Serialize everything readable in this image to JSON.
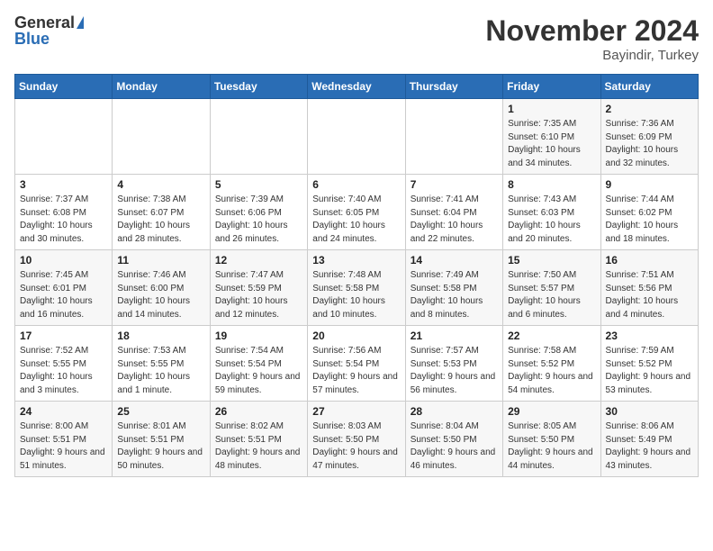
{
  "header": {
    "logo_general": "General",
    "logo_blue": "Blue",
    "month_title": "November 2024",
    "location": "Bayindir, Turkey"
  },
  "days_of_week": [
    "Sunday",
    "Monday",
    "Tuesday",
    "Wednesday",
    "Thursday",
    "Friday",
    "Saturday"
  ],
  "weeks": [
    [
      {
        "day": "",
        "sunrise": "",
        "sunset": "",
        "daylight": ""
      },
      {
        "day": "",
        "sunrise": "",
        "sunset": "",
        "daylight": ""
      },
      {
        "day": "",
        "sunrise": "",
        "sunset": "",
        "daylight": ""
      },
      {
        "day": "",
        "sunrise": "",
        "sunset": "",
        "daylight": ""
      },
      {
        "day": "",
        "sunrise": "",
        "sunset": "",
        "daylight": ""
      },
      {
        "day": "1",
        "sunrise": "Sunrise: 7:35 AM",
        "sunset": "Sunset: 6:10 PM",
        "daylight": "Daylight: 10 hours and 34 minutes."
      },
      {
        "day": "2",
        "sunrise": "Sunrise: 7:36 AM",
        "sunset": "Sunset: 6:09 PM",
        "daylight": "Daylight: 10 hours and 32 minutes."
      }
    ],
    [
      {
        "day": "3",
        "sunrise": "Sunrise: 7:37 AM",
        "sunset": "Sunset: 6:08 PM",
        "daylight": "Daylight: 10 hours and 30 minutes."
      },
      {
        "day": "4",
        "sunrise": "Sunrise: 7:38 AM",
        "sunset": "Sunset: 6:07 PM",
        "daylight": "Daylight: 10 hours and 28 minutes."
      },
      {
        "day": "5",
        "sunrise": "Sunrise: 7:39 AM",
        "sunset": "Sunset: 6:06 PM",
        "daylight": "Daylight: 10 hours and 26 minutes."
      },
      {
        "day": "6",
        "sunrise": "Sunrise: 7:40 AM",
        "sunset": "Sunset: 6:05 PM",
        "daylight": "Daylight: 10 hours and 24 minutes."
      },
      {
        "day": "7",
        "sunrise": "Sunrise: 7:41 AM",
        "sunset": "Sunset: 6:04 PM",
        "daylight": "Daylight: 10 hours and 22 minutes."
      },
      {
        "day": "8",
        "sunrise": "Sunrise: 7:43 AM",
        "sunset": "Sunset: 6:03 PM",
        "daylight": "Daylight: 10 hours and 20 minutes."
      },
      {
        "day": "9",
        "sunrise": "Sunrise: 7:44 AM",
        "sunset": "Sunset: 6:02 PM",
        "daylight": "Daylight: 10 hours and 18 minutes."
      }
    ],
    [
      {
        "day": "10",
        "sunrise": "Sunrise: 7:45 AM",
        "sunset": "Sunset: 6:01 PM",
        "daylight": "Daylight: 10 hours and 16 minutes."
      },
      {
        "day": "11",
        "sunrise": "Sunrise: 7:46 AM",
        "sunset": "Sunset: 6:00 PM",
        "daylight": "Daylight: 10 hours and 14 minutes."
      },
      {
        "day": "12",
        "sunrise": "Sunrise: 7:47 AM",
        "sunset": "Sunset: 5:59 PM",
        "daylight": "Daylight: 10 hours and 12 minutes."
      },
      {
        "day": "13",
        "sunrise": "Sunrise: 7:48 AM",
        "sunset": "Sunset: 5:58 PM",
        "daylight": "Daylight: 10 hours and 10 minutes."
      },
      {
        "day": "14",
        "sunrise": "Sunrise: 7:49 AM",
        "sunset": "Sunset: 5:58 PM",
        "daylight": "Daylight: 10 hours and 8 minutes."
      },
      {
        "day": "15",
        "sunrise": "Sunrise: 7:50 AM",
        "sunset": "Sunset: 5:57 PM",
        "daylight": "Daylight: 10 hours and 6 minutes."
      },
      {
        "day": "16",
        "sunrise": "Sunrise: 7:51 AM",
        "sunset": "Sunset: 5:56 PM",
        "daylight": "Daylight: 10 hours and 4 minutes."
      }
    ],
    [
      {
        "day": "17",
        "sunrise": "Sunrise: 7:52 AM",
        "sunset": "Sunset: 5:55 PM",
        "daylight": "Daylight: 10 hours and 3 minutes."
      },
      {
        "day": "18",
        "sunrise": "Sunrise: 7:53 AM",
        "sunset": "Sunset: 5:55 PM",
        "daylight": "Daylight: 10 hours and 1 minute."
      },
      {
        "day": "19",
        "sunrise": "Sunrise: 7:54 AM",
        "sunset": "Sunset: 5:54 PM",
        "daylight": "Daylight: 9 hours and 59 minutes."
      },
      {
        "day": "20",
        "sunrise": "Sunrise: 7:56 AM",
        "sunset": "Sunset: 5:54 PM",
        "daylight": "Daylight: 9 hours and 57 minutes."
      },
      {
        "day": "21",
        "sunrise": "Sunrise: 7:57 AM",
        "sunset": "Sunset: 5:53 PM",
        "daylight": "Daylight: 9 hours and 56 minutes."
      },
      {
        "day": "22",
        "sunrise": "Sunrise: 7:58 AM",
        "sunset": "Sunset: 5:52 PM",
        "daylight": "Daylight: 9 hours and 54 minutes."
      },
      {
        "day": "23",
        "sunrise": "Sunrise: 7:59 AM",
        "sunset": "Sunset: 5:52 PM",
        "daylight": "Daylight: 9 hours and 53 minutes."
      }
    ],
    [
      {
        "day": "24",
        "sunrise": "Sunrise: 8:00 AM",
        "sunset": "Sunset: 5:51 PM",
        "daylight": "Daylight: 9 hours and 51 minutes."
      },
      {
        "day": "25",
        "sunrise": "Sunrise: 8:01 AM",
        "sunset": "Sunset: 5:51 PM",
        "daylight": "Daylight: 9 hours and 50 minutes."
      },
      {
        "day": "26",
        "sunrise": "Sunrise: 8:02 AM",
        "sunset": "Sunset: 5:51 PM",
        "daylight": "Daylight: 9 hours and 48 minutes."
      },
      {
        "day": "27",
        "sunrise": "Sunrise: 8:03 AM",
        "sunset": "Sunset: 5:50 PM",
        "daylight": "Daylight: 9 hours and 47 minutes."
      },
      {
        "day": "28",
        "sunrise": "Sunrise: 8:04 AM",
        "sunset": "Sunset: 5:50 PM",
        "daylight": "Daylight: 9 hours and 46 minutes."
      },
      {
        "day": "29",
        "sunrise": "Sunrise: 8:05 AM",
        "sunset": "Sunset: 5:50 PM",
        "daylight": "Daylight: 9 hours and 44 minutes."
      },
      {
        "day": "30",
        "sunrise": "Sunrise: 8:06 AM",
        "sunset": "Sunset: 5:49 PM",
        "daylight": "Daylight: 9 hours and 43 minutes."
      }
    ]
  ]
}
